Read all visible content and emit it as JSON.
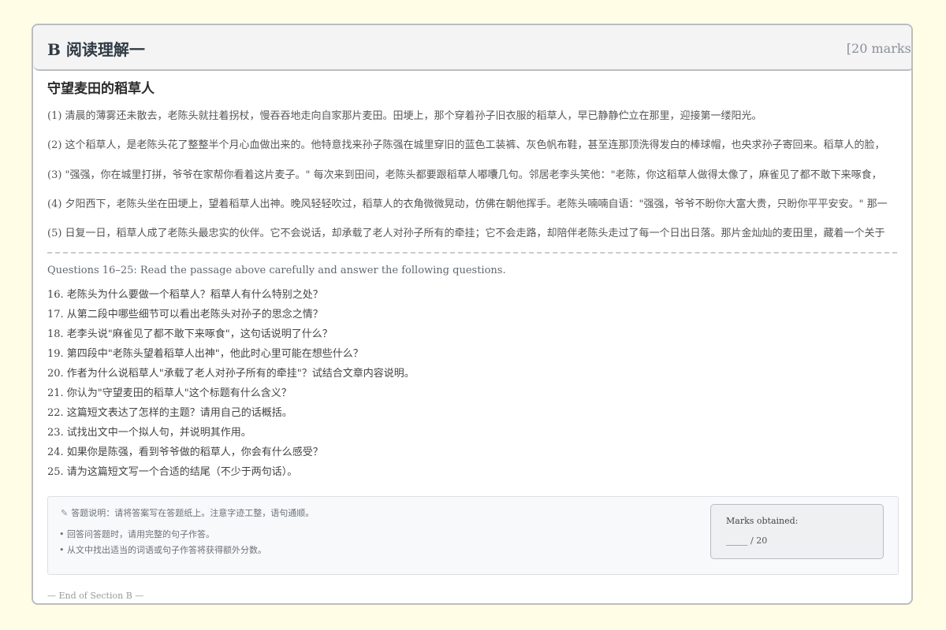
{
  "section": {
    "title": "B 阅读理解一",
    "marks": "[20 marks]"
  },
  "passage": {
    "title": "守望麦田的稻草人",
    "paragraphs": [
      "(1) 清晨的薄雾还未散去，老陈头就拄着拐杖，慢吞吞地走向自家那片麦田。田埂上，那个穿着孙子旧衣服的稻草人，早已静静伫立在那里，迎接第一缕阳光。",
      "(2) 这个稻草人，是老陈头花了整整半个月心血做出来的。他特意找来孙子陈强在城里穿旧的蓝色工装裤、灰色帆布鞋，甚至连那顶洗得发白的棒球帽，也央求孙子寄回来。稻草人的脸，",
      "(3) \"强强，你在城里打拼，爷爷在家帮你看着这片麦子。\" 每次来到田间，老陈头都要跟稻草人嘟囔几句。邻居老李头笑他：\"老陈，你这稻草人做得太像了，麻雀见了都不敢下来啄食，",
      "(4) 夕阳西下，老陈头坐在田埂上，望着稻草人出神。晚风轻轻吹过，稻草人的衣角微微晃动，仿佛在朝他挥手。老陈头喃喃自语：\"强强，爷爷不盼你大富大贵，只盼你平平安安。\" 那一",
      "(5) 日复一日，稻草人成了老陈头最忠实的伙伴。它不会说话，却承载了老人对孙子所有的牵挂；它不会走路，却陪伴老陈头走过了每一个日出日落。那片金灿灿的麦田里，藏着一个关于"
    ]
  },
  "questions": {
    "intro": "Questions 16–25: Read the passage above carefully and answer the following questions.",
    "items": [
      "16. 老陈头为什么要做一个稻草人？稻草人有什么特别之处？",
      "17. 从第二段中哪些细节可以看出老陈头对孙子的思念之情？",
      "18. 老李头说\"麻雀见了都不敢下来啄食\"，这句话说明了什么？",
      "19. 第四段中\"老陈头望着稻草人出神\"，他此时心里可能在想些什么？",
      "20. 作者为什么说稻草人\"承载了老人对孙子所有的牵挂\"？试结合文章内容说明。",
      "21. 你认为\"守望麦田的稻草人\"这个标题有什么含义？",
      "22. 这篇短文表达了怎样的主题？请用自己的话概括。",
      "23. 试找出文中一个拟人句，并说明其作用。",
      "24. 如果你是陈强，看到爷爷做的稻草人，你会有什么感受？",
      "25. 请为这篇短文写一个合适的结尾（不少于两句话）。"
    ]
  },
  "instructions": {
    "icon": "pencil-icon",
    "main": "答题说明：请将答案写在答题纸上。注意字迹工整，语句通顺。",
    "bullets": [
      "• 回答问答题时，请用完整的句子作答。",
      "• 从文中找出适当的词语或句子作答将获得额外分数。"
    ]
  },
  "marks_box": {
    "label": "Marks obtained:",
    "value": "_____ / 20"
  },
  "footer": "— End of Section B —"
}
